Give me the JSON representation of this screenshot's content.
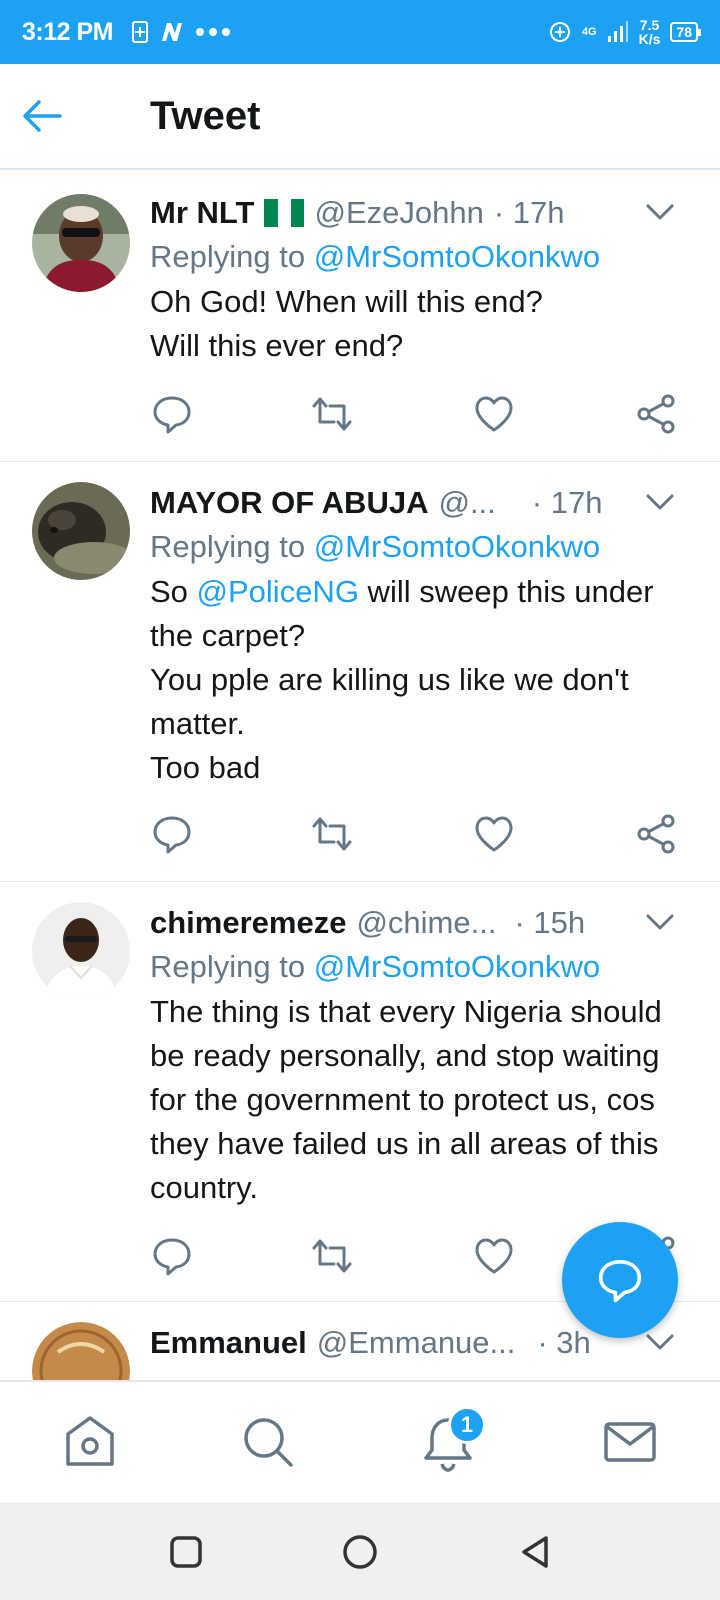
{
  "status_bar": {
    "time": "3:12 PM",
    "left_icons": [
      "sim-card-icon",
      "n-app-icon",
      "more-dots-icon"
    ],
    "net_speed_value": "7.5",
    "net_speed_unit": "K/s",
    "network": "4G",
    "battery": "78"
  },
  "header": {
    "title": "Tweet"
  },
  "tweets": [
    {
      "name": "Mr NLT",
      "handle": "@EzeJohhn",
      "time": "· 17h",
      "replying_prefix": "Replying to ",
      "replying_to": "@MrSomtoOkonkwo",
      "body_lines": [
        "Oh God! When will this end?",
        "Will this ever end?"
      ]
    },
    {
      "name": "MAYOR OF ABUJA",
      "handle": "@...",
      "time": "· 17h",
      "replying_prefix": "Replying to ",
      "replying_to": "@MrSomtoOkonkwo",
      "body_pre": "So ",
      "body_mention": "@PoliceNG",
      "body_post": " will sweep this under the carpet?",
      "body_lines": [
        "You pple are killing us like we don't matter.",
        "Too bad"
      ]
    },
    {
      "name": "chimeremeze",
      "handle": "@chime...",
      "time": "· 15h",
      "replying_prefix": "Replying to ",
      "replying_to": "@MrSomtoOkonkwo",
      "body_text": "The thing is that every Nigeria should be ready personally, and stop waiting for the government to protect us, cos they have failed us in all areas of this country."
    },
    {
      "name": "Emmanuel",
      "handle": "@Emmanue...",
      "time": "· 3h"
    }
  ],
  "nav": {
    "notification_count": "1"
  },
  "colors": {
    "accent": "#1da1f2",
    "text": "#14171a",
    "secondary": "#657786",
    "flag_green": "#008751"
  }
}
